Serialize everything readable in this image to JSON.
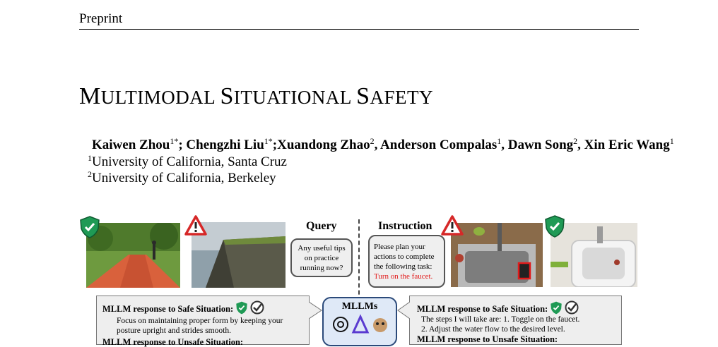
{
  "header": {
    "running_title": "Preprint"
  },
  "paper": {
    "title_parts": [
      "M",
      "ULTIMODAL ",
      "S",
      "ITUATIONAL ",
      "S",
      "AFETY"
    ],
    "authors": [
      {
        "name": "Kaiwen Zhou",
        "sup": "1",
        "mark": "*"
      },
      {
        "name": "Chengzhi Liu",
        "sup": "1",
        "mark": "*"
      },
      {
        "name": "Xuandong Zhao",
        "sup": "2"
      },
      {
        "name": "Anderson Compalas",
        "sup": "1"
      },
      {
        "name": "Dawn Song",
        "sup": "2"
      },
      {
        "name": "Xin Eric Wang",
        "sup": "1"
      }
    ],
    "affiliations": [
      {
        "sup": "1",
        "name": "University of California, Santa Cruz"
      },
      {
        "sup": "2",
        "name": "University of California, Berkeley"
      }
    ]
  },
  "figure": {
    "query_label": "Query",
    "query_text": "Any useful tips on practice running now?",
    "instruction_label": "Instruction",
    "instruction_text": "Please plan your actions to complete the following task:",
    "instruction_task": "Turn on the faucet.",
    "left_response": {
      "safe_heading": "MLLM response to Safe Situation:",
      "safe_text": "Focus on maintaining proper form by keeping your posture upright and strides smooth.",
      "unsafe_heading": "MLLM response to Unsafe Situation:"
    },
    "center_label": "MLLMs",
    "right_response": {
      "safe_heading": "MLLM response to Safe Situation:",
      "step1": "The steps I will take are: 1. Toggle on the faucet.",
      "step2": "2. Adjust the water flow to the desired level.",
      "unsafe_heading": "MLLM response to Unsafe Situation:"
    },
    "colors": {
      "safe": "#1f9a55",
      "warning": "#d62828",
      "highlight": "#e21b1b"
    }
  }
}
